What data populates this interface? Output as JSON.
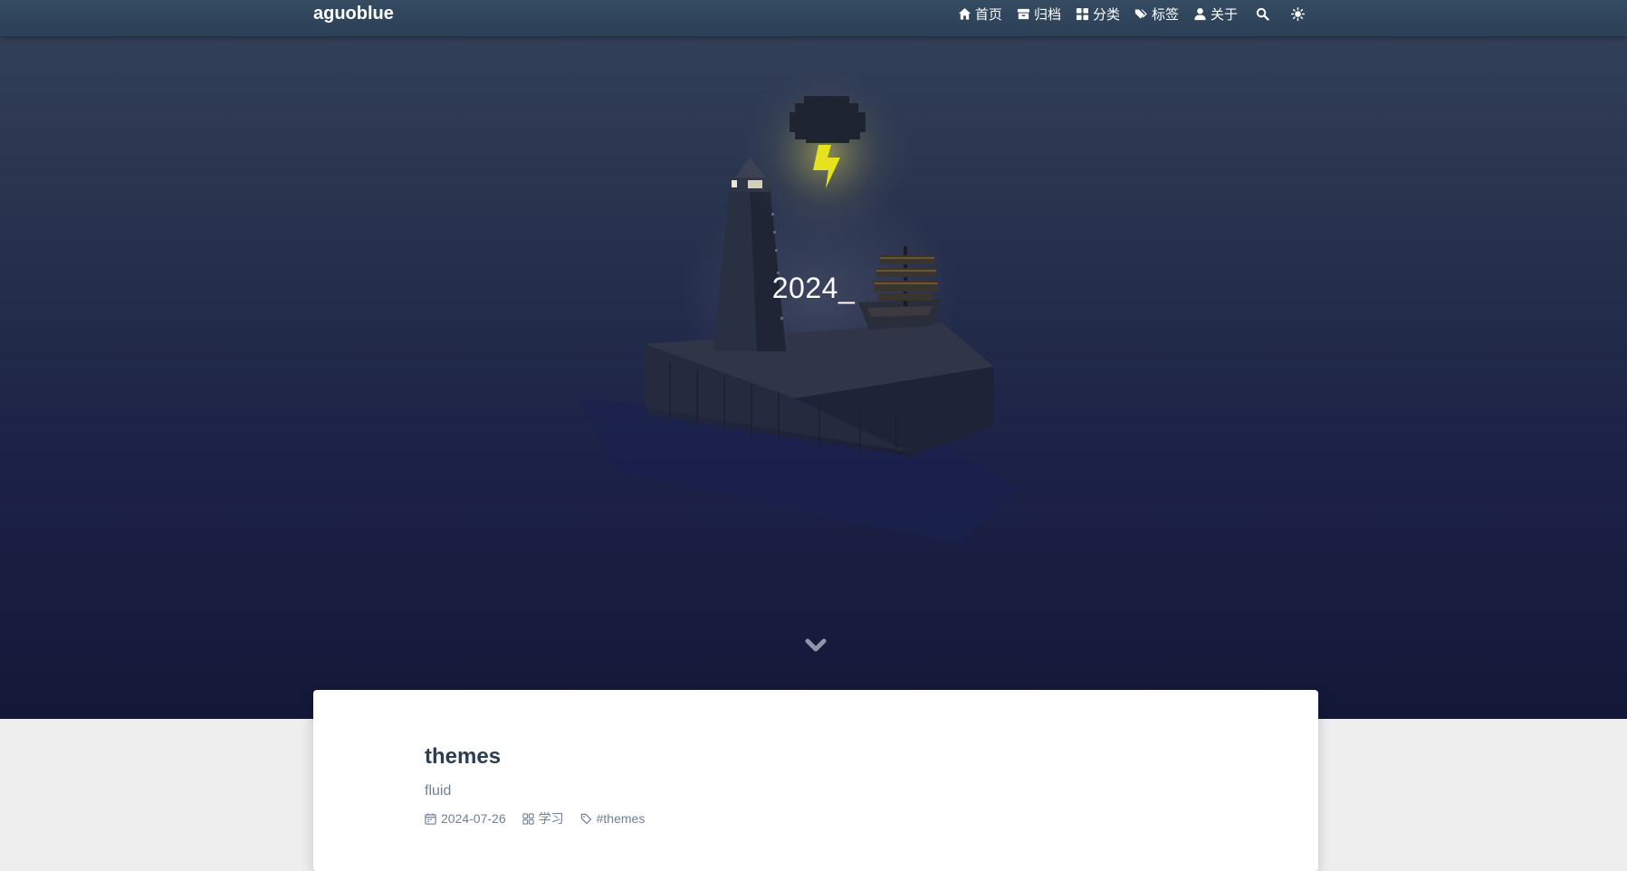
{
  "navbar": {
    "brand": "aguoblue",
    "items": [
      {
        "label": "首页",
        "icon": "home-icon"
      },
      {
        "label": "归档",
        "icon": "archive-icon"
      },
      {
        "label": "分类",
        "icon": "category-icon"
      },
      {
        "label": "标签",
        "icon": "tags-icon"
      },
      {
        "label": "关于",
        "icon": "user-icon"
      }
    ],
    "search_icon": "search-icon",
    "theme_icon": "sun-icon"
  },
  "banner": {
    "title": "2024_",
    "scroll_icon": "chevron-down-icon"
  },
  "post": {
    "title": "themes",
    "excerpt": "fluid",
    "date": "2024-07-26",
    "category": "学习",
    "tag": "#themes"
  },
  "colors": {
    "navbar_bg": "#2f455b",
    "banner_top": "#34425a",
    "banner_bottom": "#141838",
    "page_bg": "#eeeeee",
    "title_text": "#2c3e50",
    "meta_text": "#718096",
    "lightning": "#e6e21e"
  }
}
